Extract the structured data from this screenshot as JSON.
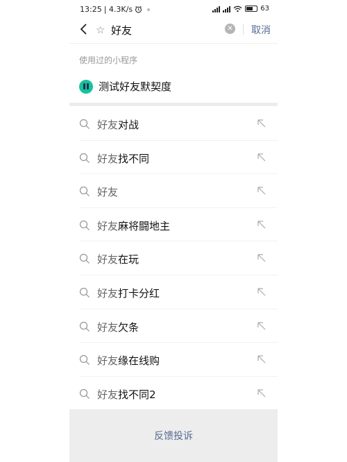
{
  "status_bar": {
    "time": "13:25",
    "speed": "| 4.3K/s",
    "alarm_icon": "alarm-icon",
    "battery": "63"
  },
  "search": {
    "value": "好友",
    "cancel_label": "取消"
  },
  "recent_mini_programs": {
    "title": "使用过的小程序",
    "items": [
      {
        "name": "测试好友默契度",
        "icon_color": "#15c39a"
      }
    ]
  },
  "suggestions": [
    {
      "highlight": "好友",
      "rest": "对战"
    },
    {
      "highlight": "好友",
      "rest": "找不同"
    },
    {
      "highlight": "好友",
      "rest": ""
    },
    {
      "highlight": "好友",
      "rest": "麻将闘地主"
    },
    {
      "highlight": "好友",
      "rest": "在玩"
    },
    {
      "highlight": "好友",
      "rest": "打卡分红"
    },
    {
      "highlight": "好友",
      "rest": "欠条"
    },
    {
      "highlight": "好友",
      "rest": "缘在线购"
    },
    {
      "highlight": "好友",
      "rest": "找不同2"
    }
  ],
  "footer": {
    "feedback_label": "反馈投诉"
  },
  "colors": {
    "link": "#576b95",
    "footer_bg": "#ededed"
  }
}
